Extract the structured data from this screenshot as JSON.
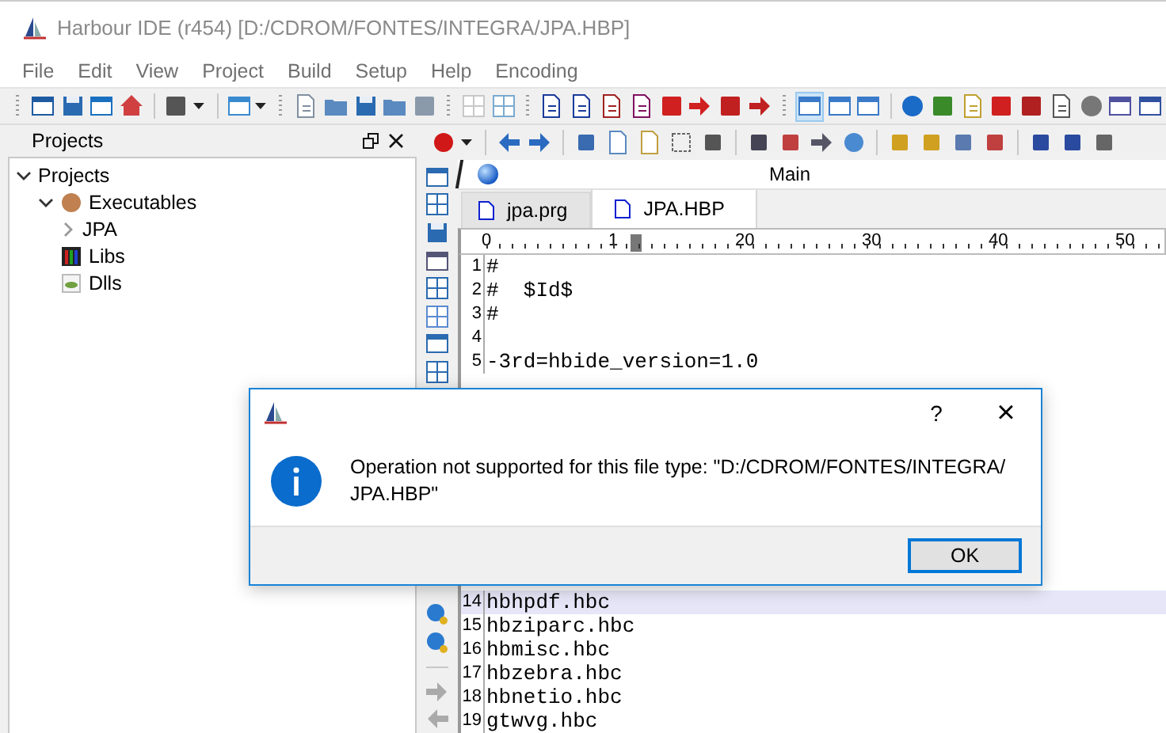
{
  "window": {
    "title": "Harbour IDE (r454) [D:/CDROM/FONTES/INTEGRA/JPA.HBP]"
  },
  "menu": [
    "File",
    "Edit",
    "View",
    "Project",
    "Build",
    "Setup",
    "Help",
    "Encoding"
  ],
  "projects_panel": {
    "title": "Projects",
    "tree": [
      {
        "label": "Projects",
        "expanded": true,
        "children": [
          {
            "label": "Executables",
            "kind": "executables",
            "expanded": true,
            "children": [
              {
                "label": "JPA",
                "expanded": false
              }
            ]
          },
          {
            "label": "Libs",
            "kind": "libs"
          },
          {
            "label": "Dlls",
            "kind": "dlls"
          }
        ]
      }
    ]
  },
  "editor": {
    "title": "Main",
    "tabs": [
      {
        "label": "jpa.prg",
        "selected": false
      },
      {
        "label": "JPA.HBP",
        "selected": true
      }
    ],
    "ruler": [
      "0",
      "1",
      "20",
      "30",
      "40",
      "50"
    ],
    "lines": [
      {
        "number": "1",
        "text": "#",
        "current": false
      },
      {
        "number": "2",
        "text": "#  $Id$",
        "current": false
      },
      {
        "number": "3",
        "text": "#",
        "current": false
      },
      {
        "number": "4",
        "current": false
      },
      {
        "number": "5",
        "text": "-3rd=hbide_version=1.0",
        "current": false
      },
      {
        "number": "14",
        "text": "hbhpdf.hbc",
        "current": true
      },
      {
        "number": "15",
        "text": "hbziparc.hbc",
        "current": false
      },
      {
        "number": "16",
        "text": "hbmisc.hbc",
        "current": false
      },
      {
        "number": "17",
        "text": "hbzebra.hbc",
        "current": false
      },
      {
        "number": "18",
        "text": "hbnetio.hbc",
        "current": false
      },
      {
        "number": "19",
        "text": "gtwvg.hbc",
        "current": false
      }
    ]
  },
  "dialog": {
    "help_button": "?",
    "close_button": "×",
    "message": "Operation not supported for this file type: \"D:/CDROM/FONTES/INTEGRA/\nJPA.HBP\"",
    "ok_button": "OK"
  }
}
